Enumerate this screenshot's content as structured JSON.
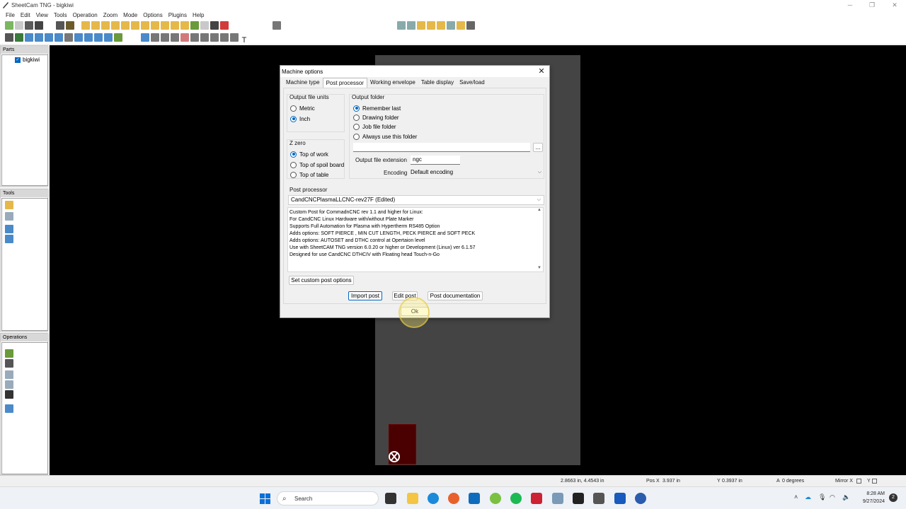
{
  "window": {
    "title": "SheetCam TNG - bigkiwi"
  },
  "menu": [
    "File",
    "Edit",
    "View",
    "Tools",
    "Operation",
    "Zoom",
    "Mode",
    "Options",
    "Plugins",
    "Help"
  ],
  "panels": {
    "parts": {
      "label": "Parts",
      "items": [
        "bigkiwi"
      ]
    },
    "tools": {
      "label": "Tools"
    },
    "operations": {
      "label": "Operations"
    }
  },
  "dialog": {
    "title": "Machine options",
    "tabs": [
      "Machine type",
      "Post processor",
      "Working envelope",
      "Table display",
      "Save/load"
    ],
    "active_tab": "Post processor",
    "output_units": {
      "label": "Output file units",
      "options": [
        "Metric",
        "Inch"
      ],
      "selected": "Inch"
    },
    "z_zero": {
      "label": "Z zero",
      "options": [
        "Top of work",
        "Top of spoil board",
        "Top of table"
      ],
      "selected": "Top of work"
    },
    "output_folder": {
      "label": "Output folder",
      "options": [
        "Remember last",
        "Drawing folder",
        "Job file folder",
        "Always use this folder"
      ],
      "selected": "Remember last",
      "path": "",
      "browse": "..."
    },
    "extension": {
      "label": "Output file extension",
      "value": "ngc"
    },
    "encoding": {
      "label": "Encoding",
      "value": "Default encoding"
    },
    "post": {
      "label": "Post processor",
      "value": "CandCNCPlasmaLLCNC-rev27F (Edited)",
      "description": [
        "Custom Post for CommadnCNC rev 1.1 and higher for Linux:",
        "For CandCNC Linux Hardware with/without Plate Marker",
        "Supports Full Automation for Plasma with Hypertherm RS485 Option",
        "Adds options:  SOFT PIERCE ,  MIN CUT LENGTH, PECK PIERCE and SOFT PECK",
        "Adds options: AUTOSET and DTHC control at Opertaion level",
        "Use with SheetCAM TNG version 6.0.20 or higher or Development (Linux)  ver 6.1.57",
        "Designed for use CandCNC DTHCIV with Floating head Touch-n-Go"
      ]
    },
    "buttons": {
      "custom": "Set custom post options",
      "import": "Import post",
      "edit": "Edit post",
      "docs": "Post documentation",
      "ok": "Ok"
    }
  },
  "status": {
    "coords": "2.8663 in, 4.4543 in",
    "pos_x_label": "Pos X",
    "pos_x": "3.937 in",
    "y_label": "Y",
    "y": "0.3937 in",
    "a_label": "A",
    "a": "0 degrees",
    "mirror": "Mirror X",
    "mirror_y": "Y"
  },
  "taskbar": {
    "search": "Search",
    "time": "8:28 AM",
    "date": "9/27/2024"
  },
  "colors": {
    "accent": "#0067c0",
    "canvas": "#000000",
    "sheet": "#444444",
    "part": "#4a0000"
  }
}
